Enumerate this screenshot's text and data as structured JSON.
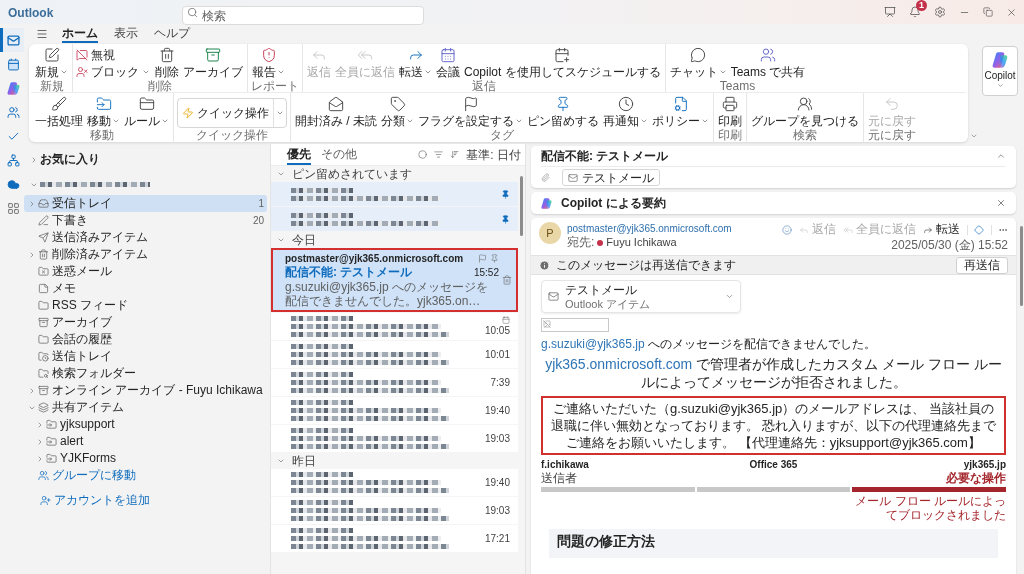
{
  "title_bar": {
    "app_name": "Outlook",
    "search": {
      "placeholder": "検索"
    },
    "notification_badge": "1"
  },
  "app_rail": [
    {
      "kind": "mail",
      "selected": true
    },
    {
      "kind": "calendar",
      "selected": false
    },
    {
      "kind": "copilot",
      "selected": false
    },
    {
      "kind": "people",
      "selected": false
    },
    {
      "kind": "todo",
      "selected": false
    },
    {
      "kind": "org",
      "selected": false
    },
    {
      "kind": "cloud",
      "selected": false
    },
    {
      "kind": "apps",
      "selected": false
    }
  ],
  "ribbon_tabs": [
    {
      "label": "ホーム",
      "selected": true
    },
    {
      "label": "表示",
      "selected": false
    },
    {
      "label": "ヘルプ",
      "selected": false
    }
  ],
  "ribbon": {
    "groups": [
      {
        "label": "新規",
        "buttons": [
          {
            "kind": "new_mail",
            "label": "新規",
            "dropdown": true,
            "disabled": false
          }
        ]
      },
      {
        "label": "削除",
        "small_buttons": [
          {
            "kind": "ignore",
            "label": "無視",
            "dropdown": false,
            "disabled": false
          },
          {
            "kind": "block",
            "label": "ブロック",
            "dropdown": true,
            "disabled": false
          }
        ],
        "buttons": [
          {
            "kind": "delete",
            "label": "削除",
            "dropdown": false,
            "disabled": false
          },
          {
            "kind": "archive",
            "label": "アーカイブ",
            "dropdown": false,
            "disabled": false
          }
        ]
      },
      {
        "label": "レポート",
        "buttons": [
          {
            "kind": "report",
            "label": "報告",
            "dropdown": true,
            "disabled": false
          }
        ]
      },
      {
        "label": "返信",
        "buttons": [
          {
            "kind": "reply",
            "label": "返信",
            "dropdown": false,
            "disabled": true
          },
          {
            "kind": "reply_all",
            "label": "全員に返信",
            "dropdown": false,
            "disabled": true
          },
          {
            "kind": "forward",
            "label": "転送",
            "dropdown": true,
            "disabled": false
          },
          {
            "kind": "meeting",
            "label": "会議",
            "dropdown": false,
            "disabled": false
          },
          {
            "kind": "copilot_schedule",
            "label": "Copilot を使用してスケジュールする",
            "dropdown": false,
            "disabled": false
          }
        ]
      },
      {
        "label": "Teams",
        "buttons": [
          {
            "kind": "chat",
            "label": "チャット",
            "dropdown": true,
            "disabled": false
          },
          {
            "kind": "teams_share",
            "label": "Teams で共有",
            "dropdown": false,
            "disabled": false
          }
        ]
      },
      {
        "label": "移動",
        "buttons": [
          {
            "kind": "sweep",
            "label": "一括処理",
            "dropdown": false,
            "disabled": false
          },
          {
            "kind": "move",
            "label": "移動",
            "dropdown": true,
            "disabled": false
          },
          {
            "kind": "rules",
            "label": "ルール",
            "dropdown": true,
            "disabled": false
          }
        ]
      },
      {
        "label": "クイック操作",
        "buttons": [
          {
            "kind": "quick_steps",
            "label": "クイック操作",
            "dropdown": true,
            "disabled": false
          }
        ]
      },
      {
        "label": "タグ",
        "buttons": [
          {
            "kind": "read_unread",
            "label": "開封済み / 未読",
            "dropdown": false,
            "disabled": false
          },
          {
            "kind": "categorize",
            "label": "分類",
            "dropdown": true,
            "disabled": false
          },
          {
            "kind": "flag",
            "label": "フラグを設定する",
            "dropdown": true,
            "disabled": false
          },
          {
            "kind": "pin",
            "label": "ピン留めする",
            "dropdown": false,
            "disabled": false
          },
          {
            "kind": "snooze",
            "label": "再通知",
            "dropdown": true,
            "disabled": false
          },
          {
            "kind": "policy",
            "label": "ポリシー",
            "dropdown": true,
            "disabled": false
          }
        ]
      },
      {
        "label": "印刷",
        "buttons": [
          {
            "kind": "print",
            "label": "印刷",
            "dropdown": false,
            "disabled": false
          }
        ]
      },
      {
        "label": "検索",
        "buttons": [
          {
            "kind": "find_groups",
            "label": "グループを見つける",
            "dropdown": false,
            "disabled": false
          }
        ]
      },
      {
        "label": "元に戻す",
        "buttons": [
          {
            "kind": "undo",
            "label": "元に戻す",
            "dropdown": false,
            "disabled": true
          }
        ]
      }
    ],
    "copilot_button": {
      "label": "Copilot",
      "dropdown": true
    }
  },
  "folder_pane": {
    "items": [
      {
        "kind": "favorites",
        "label": "お気に入り",
        "expanded": false,
        "selected": false
      },
      {
        "kind": "account",
        "expanded": true,
        "selected": false,
        "children": [
          {
            "kind": "inbox",
            "label": "受信トレイ",
            "count": "1",
            "expanded": false,
            "selected": true
          },
          {
            "kind": "drafts",
            "label": "下書き",
            "count": "20",
            "selected": false
          },
          {
            "kind": "sent",
            "label": "送信済みアイテム",
            "selected": false
          },
          {
            "kind": "deleted",
            "label": "削除済みアイテム",
            "expanded": false,
            "selected": false
          },
          {
            "kind": "junk",
            "label": "迷惑メール",
            "selected": false
          },
          {
            "kind": "notes",
            "label": "メモ",
            "selected": false
          },
          {
            "kind": "folder",
            "label": "RSS フィード",
            "selected": false
          },
          {
            "kind": "archive",
            "label": "アーカイブ",
            "selected": false
          },
          {
            "kind": "folder",
            "label": "会話の履歴",
            "selected": false
          },
          {
            "kind": "outbox",
            "label": "送信トレイ",
            "selected": false
          },
          {
            "kind": "search_folder",
            "label": "検索フォルダー",
            "selected": false
          },
          {
            "kind": "archive",
            "label": "オンライン アーカイブ - Fuyu Ichikawa",
            "expanded": false,
            "selected": false
          },
          {
            "kind": "shared",
            "label": "共有アイテム",
            "expanded": true,
            "selected": false,
            "children": [
              {
                "kind": "shared_folder",
                "label": "yjksupport",
                "expanded": false,
                "selected": false
              },
              {
                "kind": "shared_folder",
                "label": "alert",
                "expanded": false,
                "selected": false
              },
              {
                "kind": "shared_folder",
                "label": "YJKForms",
                "expanded": false,
                "selected": false
              }
            ]
          },
          {
            "kind": "groups_link",
            "label": "グループに移動",
            "selected": false
          }
        ]
      },
      {
        "kind": "add_account",
        "label": "アカウントを追加",
        "selected": false
      }
    ]
  },
  "message_list": {
    "tabs": [
      {
        "label": "優先",
        "selected": true
      },
      {
        "label": "その他",
        "selected": false
      }
    ],
    "sort_label": "基準: 日付",
    "groups": [
      {
        "label": "ピン留めされています",
        "expanded": true,
        "messages": [
          {
            "kind": "mail",
            "pinned": true,
            "selected": false,
            "highlighted": false
          },
          {
            "kind": "mail",
            "pinned": true,
            "selected": false,
            "highlighted": false
          }
        ]
      },
      {
        "label": "今日",
        "expanded": true,
        "messages": [
          {
            "kind": "mail",
            "sender": "postmaster@yjk365.onmicrosoft.com",
            "subject": "配信不能: テストメール",
            "time": "15:52",
            "preview": "g.suzuki@yjk365.jp へのメッセージを配信できませんでした。yjk365.on…",
            "pinned": false,
            "selected": true,
            "highlighted": true
          },
          {
            "kind": "meeting",
            "time": "10:05",
            "pinned": false,
            "selected": false,
            "highlighted": false
          },
          {
            "kind": "mail",
            "time": "10:01",
            "pinned": false,
            "selected": false,
            "highlighted": false
          },
          {
            "kind": "mail",
            "time": "7:39",
            "pinned": false,
            "selected": false,
            "highlighted": false
          },
          {
            "kind": "mail",
            "time": "19:40",
            "pinned": false,
            "selected": false,
            "highlighted": false
          },
          {
            "kind": "mail",
            "time": "19:03",
            "pinned": false,
            "selected": false,
            "highlighted": false
          }
        ]
      },
      {
        "label": "昨日",
        "expanded": true,
        "messages": [
          {
            "kind": "mail",
            "time": "19:40",
            "pinned": false,
            "selected": false,
            "highlighted": false
          },
          {
            "kind": "mail",
            "time": "19:03",
            "pinned": false,
            "selected": false,
            "highlighted": false
          },
          {
            "kind": "mail",
            "time": "17:21",
            "pinned": false,
            "selected": false,
            "highlighted": false
          }
        ]
      }
    ]
  },
  "reading_pane": {
    "subject": "配信不能: テストメール",
    "attachments": [
      {
        "label": "テストメール"
      }
    ],
    "summary": {
      "label": "Copilot による要約"
    },
    "message": {
      "avatar_initial": "P",
      "sender": "postmaster@yjk365.onmicrosoft.com",
      "to_label": "宛先:",
      "recipients": [
        {
          "name": "Fuyu Ichikawa",
          "color": "#c4314b"
        }
      ],
      "actions": [
        {
          "kind": "react",
          "disabled": false
        },
        {
          "kind": "reply",
          "label": "返信",
          "disabled": true
        },
        {
          "kind": "reply_all",
          "label": "全員に返信",
          "disabled": true
        },
        {
          "kind": "forward",
          "label": "転送",
          "disabled": false
        },
        {
          "kind": "apps",
          "disabled": false
        },
        {
          "kind": "more",
          "disabled": false
        }
      ],
      "date": "2025/05/30 (金) 15:52",
      "info_bar": {
        "text": "このメッセージは再送信できます",
        "button": "再送信"
      },
      "attached_item": {
        "title": "テストメール",
        "subtitle": "Outlook アイテム"
      },
      "intro": {
        "link": "g.suzuki@yjk365.jp",
        "text": "へのメッセージを配信できませんでした。"
      },
      "headline": {
        "link": "yjk365.onmicrosoft.com",
        "text": "で管理者が作成したカスタム メール フロー ルールによってメッセージが拒否されました。"
      },
      "notice": {
        "text": "ご連絡いただいた（g.suzuki@yjk365.jp）のメールアドレスは、 当該社員の退職に伴い無効となっております。 恐れ入りますが、以下の代理連絡先までご連絡をお願いいたします。 【代理連絡先：yjksupport@yjk365.com】",
        "highlighted": true
      },
      "route": [
        {
          "name": "f.ichikawa",
          "role": "送信者",
          "blocked": false
        },
        {
          "name": "Office 365",
          "blocked": false
        },
        {
          "name": "yjk365.jp",
          "role": "必要な操作",
          "blocked": true,
          "note": "メール フロー ルールによってブロックされました"
        }
      ],
      "fix_section": {
        "title": "問題の修正方法"
      }
    }
  }
}
